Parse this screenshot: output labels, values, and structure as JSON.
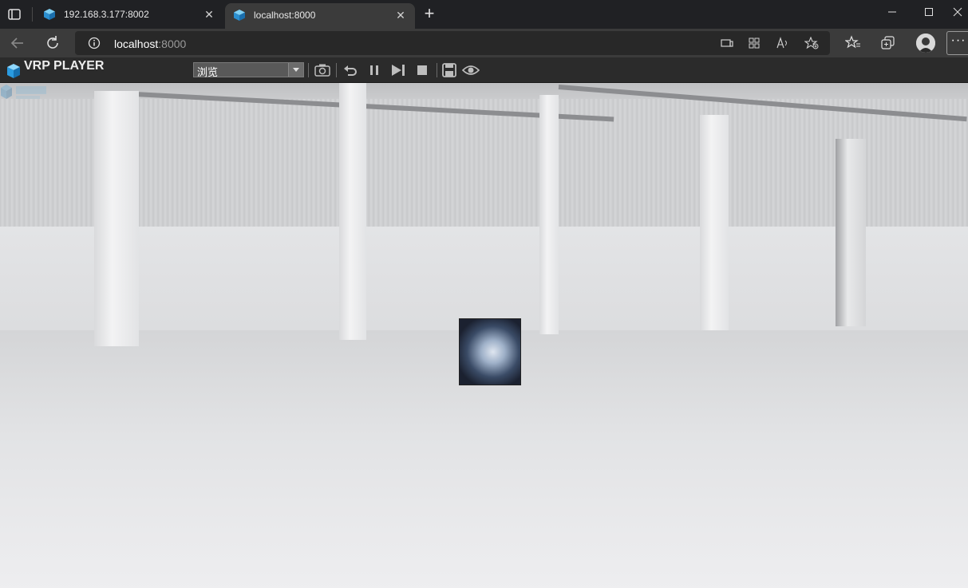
{
  "browser": {
    "tabs": [
      {
        "title": "192.168.3.177:8002",
        "active": false
      },
      {
        "title": "localhost:8000",
        "active": true
      }
    ],
    "address": {
      "host": "localhost",
      "port": ":8000"
    }
  },
  "app": {
    "title": "VRP PLAYER",
    "mode_select": {
      "value": "浏览"
    },
    "toolbar_icons": [
      "camera-icon",
      "undo-icon",
      "pause-icon",
      "step-forward-icon",
      "stop-icon",
      "save-icon",
      "eye-icon"
    ]
  },
  "colors": {
    "chrome_dark": "#202124",
    "chrome_mid": "#3b3b3b",
    "app_toolbar": "#2b2b2b",
    "brand_blue": "#3aa6e0"
  }
}
